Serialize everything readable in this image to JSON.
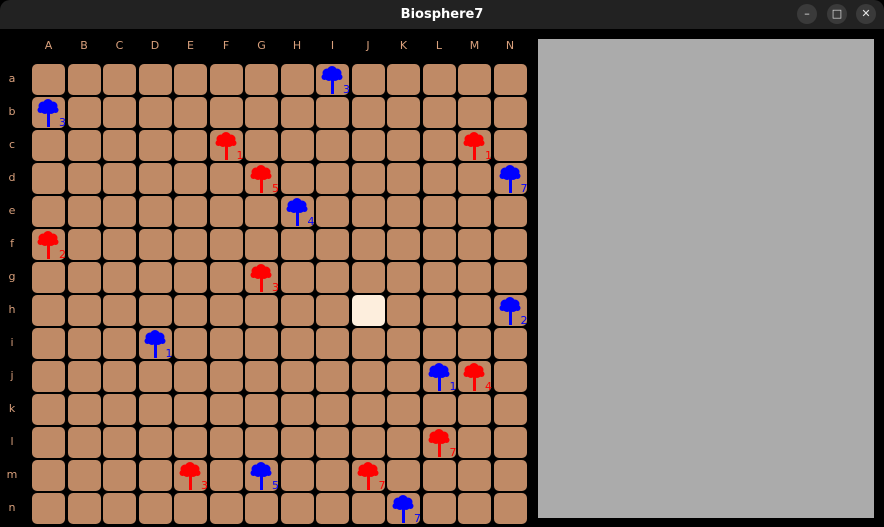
{
  "window": {
    "title": "Biosphere7",
    "min_icon": "–",
    "max_icon": "□",
    "close_icon": "✕"
  },
  "board": {
    "columns": [
      "A",
      "B",
      "C",
      "D",
      "E",
      "F",
      "G",
      "H",
      "I",
      "J",
      "K",
      "L",
      "M",
      "N"
    ],
    "rows": [
      "a",
      "b",
      "c",
      "d",
      "e",
      "f",
      "g",
      "h",
      "i",
      "j",
      "k",
      "l",
      "m",
      "n"
    ],
    "selected_cell": "hJ",
    "cell_color": "#bf8a66",
    "selected_color": "#fdeedd",
    "label_color": "#d9a07c",
    "player_colors": {
      "red": "#ff0000",
      "blue": "#0000ff"
    },
    "trees": [
      {
        "row": "a",
        "col": "I",
        "player": "blue",
        "count": "3"
      },
      {
        "row": "b",
        "col": "A",
        "player": "blue",
        "count": "3"
      },
      {
        "row": "c",
        "col": "F",
        "player": "red",
        "count": "1"
      },
      {
        "row": "c",
        "col": "M",
        "player": "red",
        "count": "1"
      },
      {
        "row": "d",
        "col": "G",
        "player": "red",
        "count": "5"
      },
      {
        "row": "d",
        "col": "N",
        "player": "blue",
        "count": "7"
      },
      {
        "row": "e",
        "col": "H",
        "player": "blue",
        "count": "4"
      },
      {
        "row": "f",
        "col": "A",
        "player": "red",
        "count": "2"
      },
      {
        "row": "g",
        "col": "G",
        "player": "red",
        "count": "3"
      },
      {
        "row": "h",
        "col": "N",
        "player": "blue",
        "count": "2"
      },
      {
        "row": "i",
        "col": "D",
        "player": "blue",
        "count": "1"
      },
      {
        "row": "j",
        "col": "L",
        "player": "blue",
        "count": "1"
      },
      {
        "row": "j",
        "col": "M",
        "player": "red",
        "count": "4"
      },
      {
        "row": "l",
        "col": "L",
        "player": "red",
        "count": "7"
      },
      {
        "row": "m",
        "col": "E",
        "player": "red",
        "count": "3"
      },
      {
        "row": "m",
        "col": "G",
        "player": "blue",
        "count": "5"
      },
      {
        "row": "m",
        "col": "J",
        "player": "red",
        "count": "7"
      },
      {
        "row": "n",
        "col": "K",
        "player": "blue",
        "count": "7"
      }
    ]
  },
  "info_panel": {
    "background": "#ababab"
  }
}
